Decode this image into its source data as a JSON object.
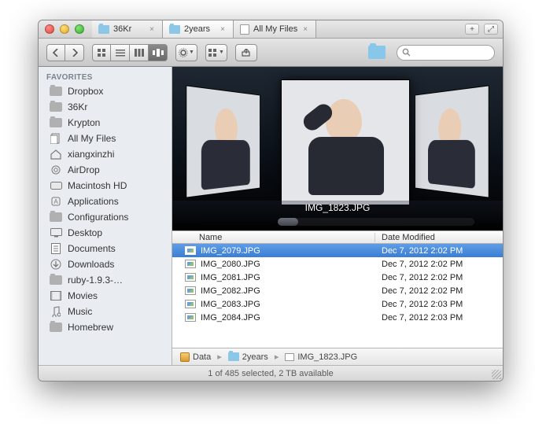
{
  "tabs": [
    {
      "label": "36Kr",
      "active": false,
      "icon": "folder"
    },
    {
      "label": "2years",
      "active": true,
      "icon": "folder"
    },
    {
      "label": "All My Files",
      "active": false,
      "icon": "allfiles"
    }
  ],
  "sidebar": {
    "header": "FAVORITES",
    "items": [
      {
        "label": "Dropbox",
        "icon": "folder-icon"
      },
      {
        "label": "36Kr",
        "icon": "folder-icon"
      },
      {
        "label": "Krypton",
        "icon": "folder-icon"
      },
      {
        "label": "All My Files",
        "icon": "allfiles-icon"
      },
      {
        "label": "xiangxinzhi",
        "icon": "home-icon"
      },
      {
        "label": "AirDrop",
        "icon": "airdrop-icon"
      },
      {
        "label": "Macintosh HD",
        "icon": "disk-icon"
      },
      {
        "label": "Applications",
        "icon": "app-icon"
      },
      {
        "label": "Configurations",
        "icon": "folder-icon"
      },
      {
        "label": "Desktop",
        "icon": "desktop-icon"
      },
      {
        "label": "Documents",
        "icon": "documents-icon"
      },
      {
        "label": "Downloads",
        "icon": "downloads-icon"
      },
      {
        "label": "ruby-1.9.3-…",
        "icon": "folder-icon"
      },
      {
        "label": "Movies",
        "icon": "movies-icon"
      },
      {
        "label": "Music",
        "icon": "music-icon"
      },
      {
        "label": "Homebrew",
        "icon": "folder-icon"
      }
    ]
  },
  "coverflow": {
    "selected_label": "IMG_1823.JPG"
  },
  "columns": {
    "name": "Name",
    "date": "Date Modified"
  },
  "files": [
    {
      "name": "IMG_2079.JPG",
      "date": "Dec 7, 2012 2:02 PM",
      "selected": true
    },
    {
      "name": "IMG_2080.JPG",
      "date": "Dec 7, 2012 2:02 PM",
      "selected": false
    },
    {
      "name": "IMG_2081.JPG",
      "date": "Dec 7, 2012 2:02 PM",
      "selected": false
    },
    {
      "name": "IMG_2082.JPG",
      "date": "Dec 7, 2012 2:02 PM",
      "selected": false
    },
    {
      "name": "IMG_2083.JPG",
      "date": "Dec 7, 2012 2:03 PM",
      "selected": false
    },
    {
      "name": "IMG_2084.JPG",
      "date": "Dec 7, 2012 2:03 PM",
      "selected": false
    }
  ],
  "path": [
    {
      "label": "Data",
      "icon": "disk"
    },
    {
      "label": "2years",
      "icon": "folder"
    },
    {
      "label": "IMG_1823.JPG",
      "icon": "pic"
    }
  ],
  "status": "1 of 485 selected, 2 TB available",
  "search": {
    "placeholder": ""
  }
}
